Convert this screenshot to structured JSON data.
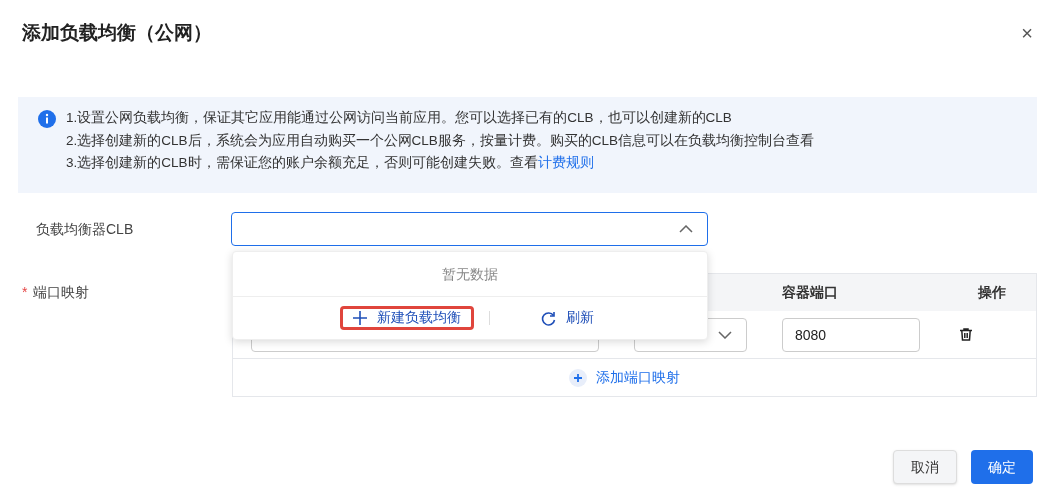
{
  "dialog": {
    "title": "添加负载均衡（公网）",
    "close": "×"
  },
  "notice": {
    "lines": [
      {
        "text": "1.设置公网负载均衡，保证其它应用能通过公网访问当前应用。您可以选择已有的CLB，也可以创建新的CLB"
      },
      {
        "text": "2.选择创建新的CLB后，系统会为应用自动购买一个公网CLB服务，按量计费。购买的CLB信息可以在负载均衡控制台查看"
      },
      {
        "text": "3.选择创建新的CLB时，需保证您的账户余额充足，否则可能创建失败。查看",
        "link": "计费规则"
      }
    ]
  },
  "clb_field": {
    "label": "负载均衡器CLB",
    "expanded": true,
    "dropdown": {
      "empty_text": "暂无数据",
      "actions": [
        {
          "kind": "create",
          "label": "新建负载均衡",
          "highlighted": true
        },
        {
          "kind": "refresh",
          "label": "刷新",
          "highlighted": false
        }
      ]
    }
  },
  "port_mapping": {
    "label": "端口映射",
    "required_mark": "*",
    "columns": [
      "容器端口",
      "操作"
    ],
    "rows": [
      {
        "container_port": "8080"
      }
    ],
    "add_label": "添加端口映射"
  },
  "footer": {
    "buttons": [
      {
        "label": "取消",
        "primary": false
      },
      {
        "label": "确定",
        "primary": true
      }
    ]
  }
}
